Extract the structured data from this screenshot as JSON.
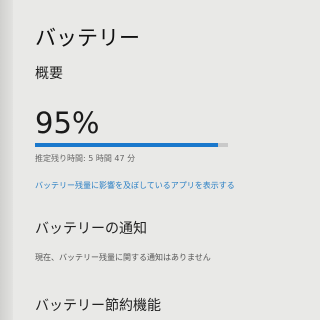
{
  "header": {
    "title": "バッテリー"
  },
  "overview": {
    "heading": "概要",
    "percent_text": "95%",
    "percent_value": 95,
    "remaining_text": "推定残り時間: 5 時間 47 分",
    "apps_link": "バッテリー残量に影響を及ぼしているアプリを表示する"
  },
  "notifications": {
    "heading": "バッテリーの通知",
    "text": "現在、バッテリー残量に関する通知はありません"
  },
  "saver": {
    "heading": "バッテリー節約機能"
  },
  "colors": {
    "accent": "#1a78cc",
    "link": "#2a7fc4",
    "background": "#e9e9e7"
  }
}
